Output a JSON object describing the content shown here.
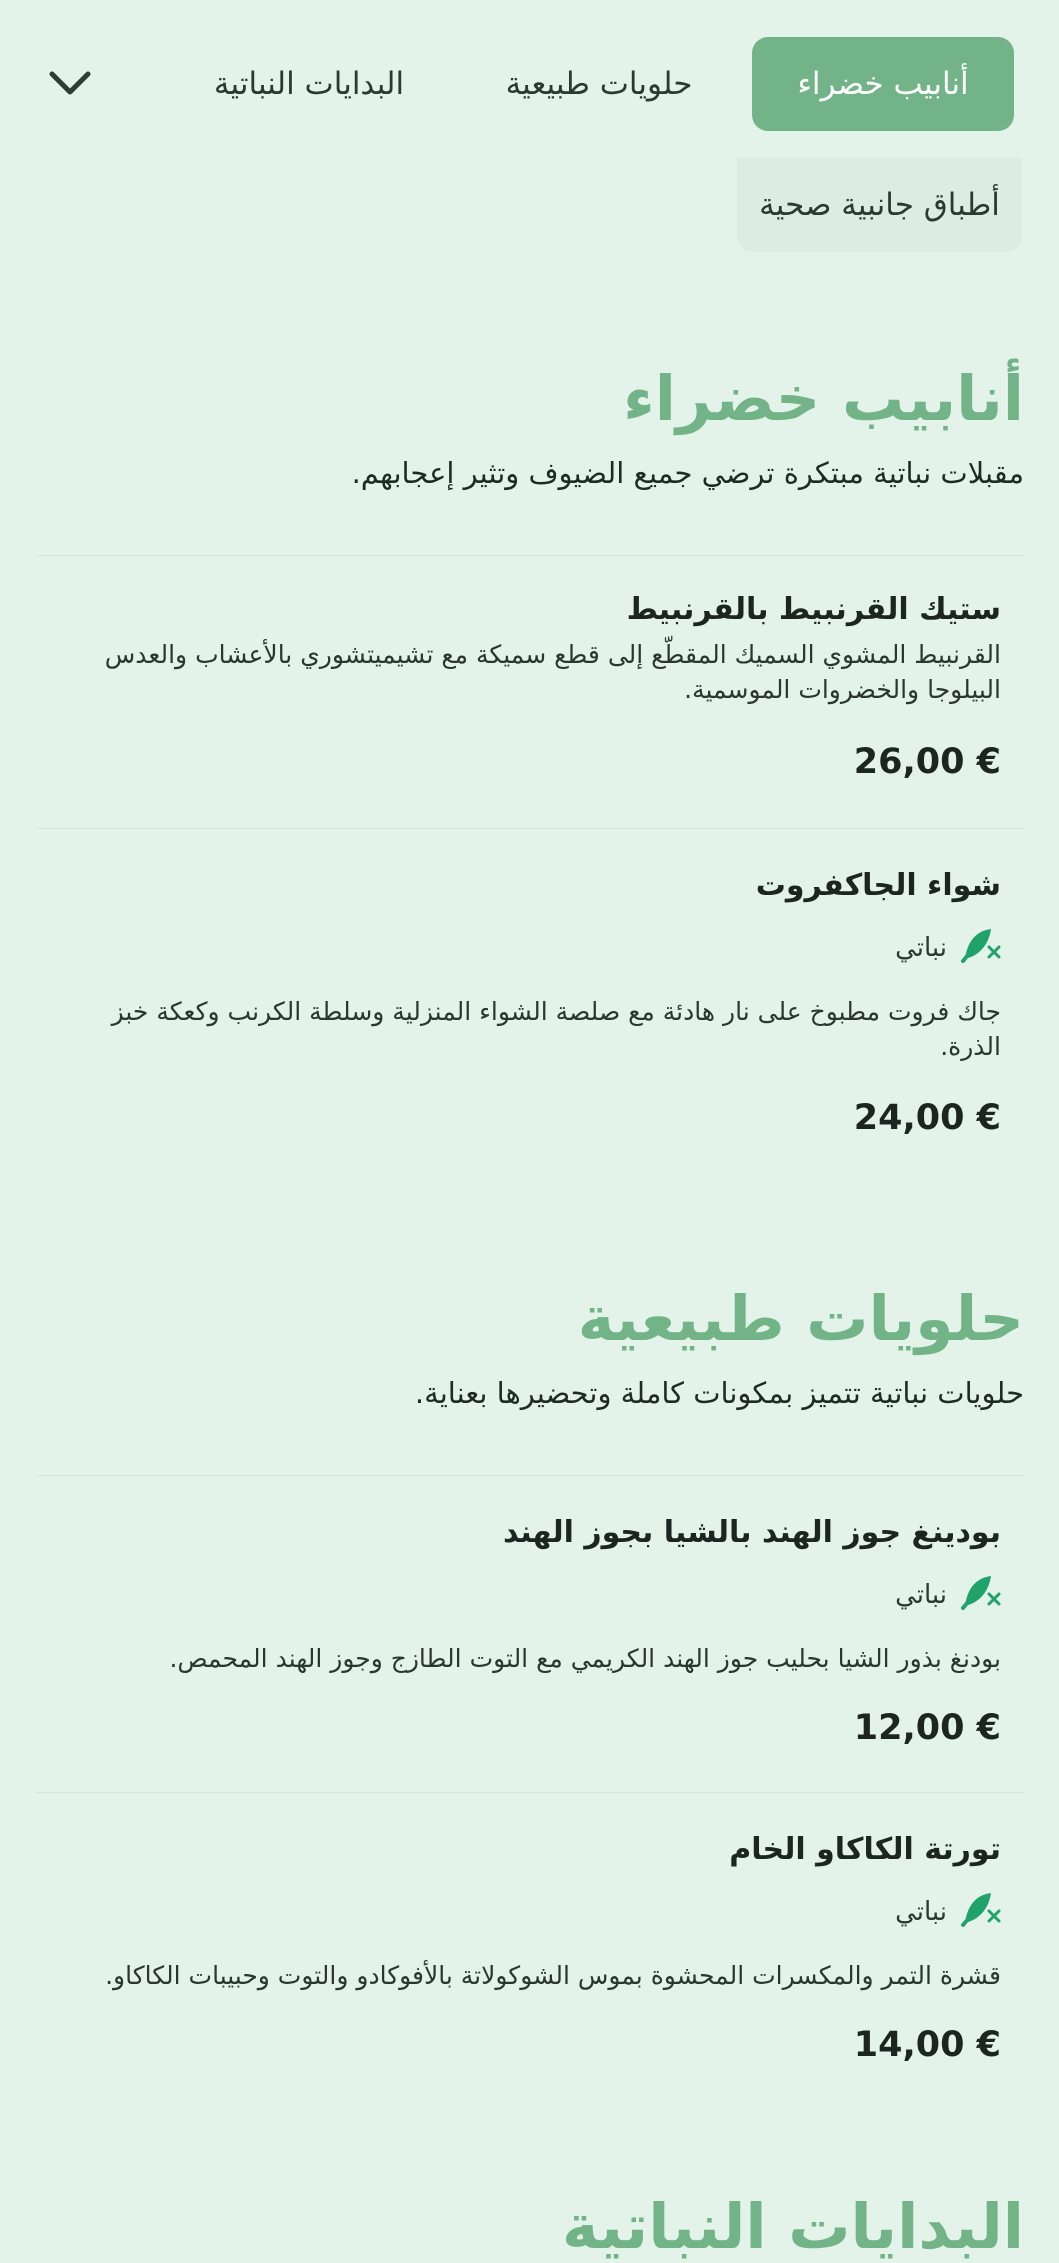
{
  "nav": {
    "tabs": [
      {
        "label": "أنابيب خضراء",
        "active": true
      },
      {
        "label": "حلويات طبيعية",
        "active": false
      },
      {
        "label": "البدايات النباتية",
        "active": false
      },
      {
        "label": "أطباق جانبية صحية",
        "active": false
      }
    ],
    "expand_icon": "chevron-down-icon"
  },
  "sections": [
    {
      "title": "أنابيب خضراء",
      "description": "مقبلات نباتية مبتكرة ترضي جميع الضيوف وتثير إعجابهم.",
      "items": [
        {
          "name": "ستيك القرنبيط بالقرنبيط",
          "description": "القرنبيط المشوي السميك المقطّع إلى قطع سميكة مع تشيميتشوري بالأعشاب والعدس البيلوجا والخضروات الموسمية.",
          "price": "26,00 €"
        },
        {
          "name": "شواء الجاكفروت",
          "badge": "نباتي",
          "description": "جاك فروت مطبوخ على نار هادئة مع صلصة الشواء المنزلية وسلطة الكرنب وكعكة خبز الذرة.",
          "price": "24,00 €"
        }
      ]
    },
    {
      "title": "حلويات طبيعية",
      "description": "حلويات نباتية تتميز بمكونات كاملة وتحضيرها بعناية.",
      "items": [
        {
          "name": "بودينغ جوز الهند بالشيا بجوز الهند",
          "badge": "نباتي",
          "description": "بودنغ بذور الشيا بحليب جوز الهند الكريمي مع التوت الطازج وجوز الهند المحمص.",
          "price": "12,00 €"
        },
        {
          "name": "تورتة الكاكاو الخام",
          "badge": "نباتي",
          "description": "قشرة التمر والمكسرات المحشوة بموس الشوكولاتة بالأفوكادو والتوت وحبيبات الكاكاو.",
          "price": "14,00 €"
        }
      ]
    },
    {
      "title": "البدايات النباتية"
    }
  ],
  "colors": {
    "background": "#e3f3ea",
    "accent": "#72b487",
    "badge_icon": "#1fa36a"
  },
  "icons": {
    "vegan_badge": "leaf-crossed-icon"
  }
}
